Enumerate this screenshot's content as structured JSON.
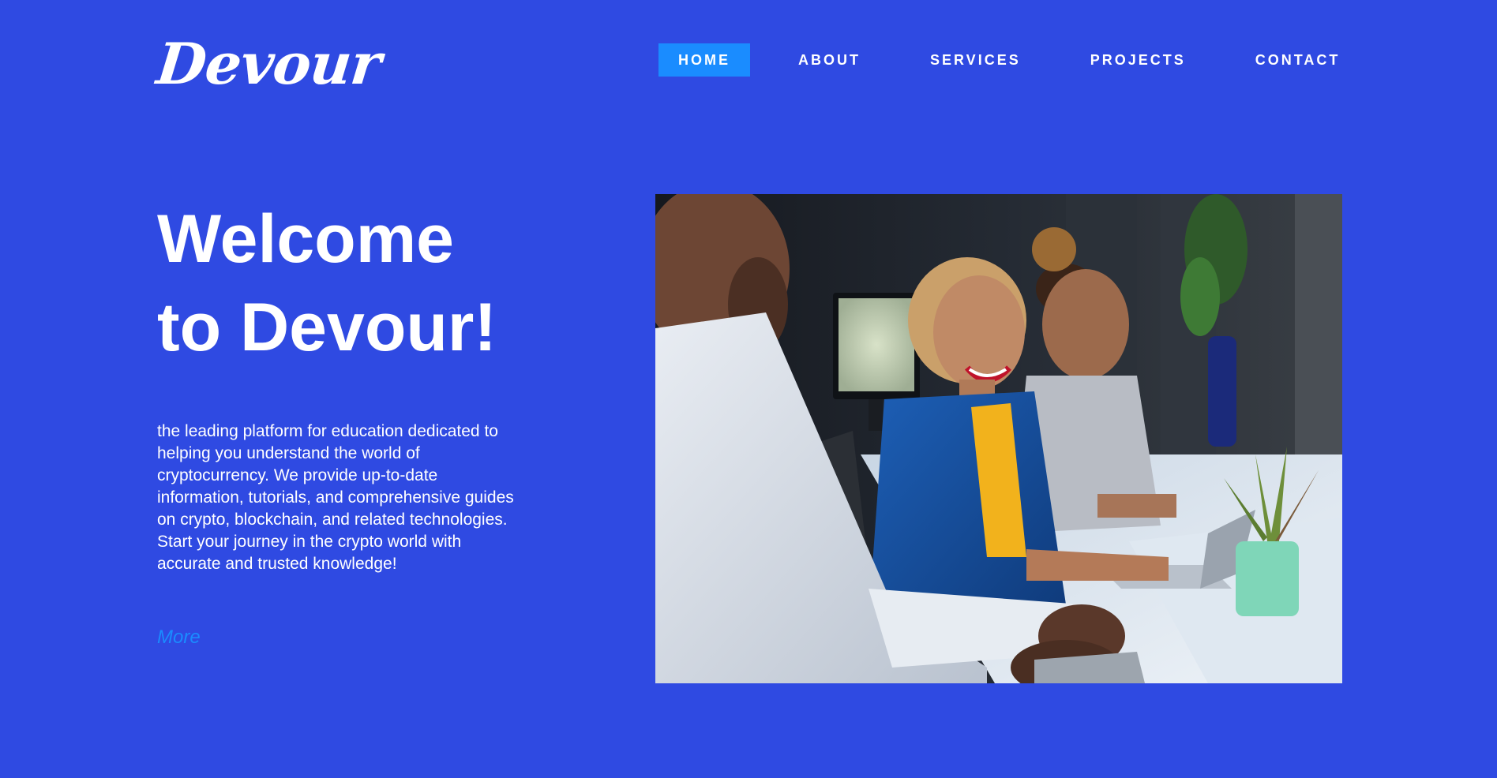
{
  "brand": {
    "logo_text": "Devour"
  },
  "nav": {
    "items": [
      {
        "label": "HOME",
        "active": true
      },
      {
        "label": "ABOUT",
        "active": false
      },
      {
        "label": "SERVICES",
        "active": false
      },
      {
        "label": "PROJECTS",
        "active": false
      },
      {
        "label": "CONTACT",
        "active": false
      }
    ]
  },
  "hero": {
    "title_line1": "Welcome",
    "title_line2": "to Devour!",
    "description": "the leading platform for education dedicated to helping you understand the world of cryptocurrency. We provide up-to-date information, tutorials, and comprehensive guides on crypto, blockchain, and related technologies. Start your journey in the crypto world with accurate and trusted knowledge!",
    "more_label": "More"
  },
  "colors": {
    "background": "#2f4ae2",
    "accent": "#1a8cff",
    "text": "#ffffff"
  }
}
